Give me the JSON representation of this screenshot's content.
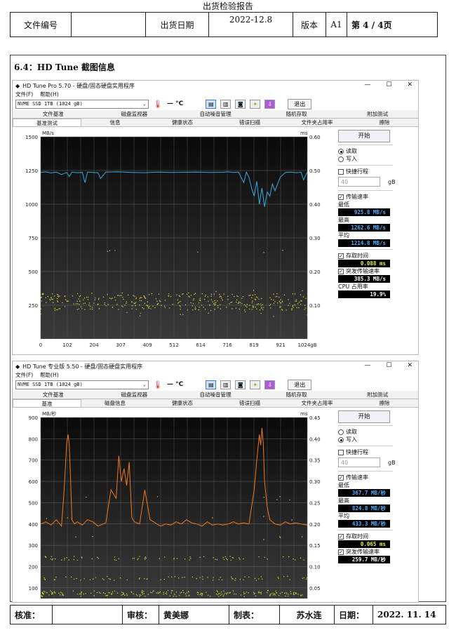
{
  "document": {
    "title": "出货检验报告",
    "section_title": "6.4：HD Tune 截图信息"
  },
  "header": {
    "doc_no_label": "文件编号",
    "doc_no_value": "",
    "ship_date_label": "出货日期",
    "ship_date_value": "2022-12.8",
    "version_label": "版本",
    "version_value": "A1",
    "page": "第 4 / 4页"
  },
  "footer": {
    "approve_label": "核准：",
    "approve_value": "",
    "review_label": "审核：",
    "review_value": "黄美娜",
    "prepare_label": "制表：",
    "prepare_value": "苏水连",
    "date_label": "日期：",
    "date_value": "2022. 11. 14"
  },
  "windows": [
    {
      "title": "HD Tune Pro 5.70 - 硬盘/固态硬盘实用程序",
      "menu": [
        "文件(F)",
        "帮助(H)"
      ],
      "drive": "NVME SSD 1TB (1024 gB)",
      "temp": "— °C",
      "exit": "退出",
      "tabs_row1": [
        "文件基准",
        "磁盘监视器",
        "自动噪音管理",
        "随机存取",
        "附加测试"
      ],
      "tabs_row2": [
        "基准测试",
        "信息",
        "健康状态",
        "错误扫描",
        "文件夹占用率",
        "擦除"
      ],
      "start": "开始",
      "read": "读取",
      "write": "写入",
      "short_stroke": "快捷行程",
      "stroke_value": "40",
      "stroke_unit": "gB",
      "transfer_rate": "传输速率",
      "min_label": "最低",
      "min_value": "925.8 MB/s",
      "max_label": "最高",
      "max_value": "1262.6 MB/s",
      "avg_label": "平均",
      "avg_value": "1214.8 MB/s",
      "access_time": "存取时间",
      "access_value": "0.088 ms",
      "burst": "突发传输速率",
      "burst_value": "385.3 MB/s",
      "cpu_label": "CPU 占用率",
      "cpu_value": "19.9%",
      "mode": "read",
      "color_line": "#39a9e0"
    },
    {
      "title": "HD Tune 专业版 5.50 - 硬盘/固态硬盘实用程序",
      "menu": [
        "文件(F)",
        "帮助(H)"
      ],
      "drive": "NVME SSD 1TB (1024 gB)",
      "temp": "— °C",
      "exit": "退出",
      "tabs_row1": [
        "文件基准",
        "磁盘监视器",
        "自动噪音管理",
        "随机存取",
        "附加测试"
      ],
      "tabs_row2": [
        "基准",
        "磁盘信息",
        "健康状态",
        "错误扫描",
        "文件夹占用率",
        "擦除"
      ],
      "start": "开始",
      "read": "读取",
      "write": "写入",
      "short_stroke": "快捷行程",
      "stroke_value": "40",
      "stroke_unit": "gB",
      "transfer_rate": "传输速率",
      "min_label": "最低",
      "min_value": "367.7 MB/秒",
      "max_label": "最高",
      "max_value": "824.8 MB/秒",
      "avg_label": "平均",
      "avg_value": "433.3 MB/秒",
      "access_time": "存取时间",
      "access_value": "0.065 ms",
      "burst": "突发传输速率",
      "burst_value": "259.7 MB/秒",
      "mode": "write",
      "color_line": "#f07a1a"
    }
  ],
  "chart_data": [
    {
      "type": "line",
      "title": "",
      "ylabel": "MB/s",
      "y2label": "ms",
      "ylim": [
        0,
        1500
      ],
      "y2lim": [
        0,
        0.6
      ],
      "yticks": [
        1500,
        1250,
        1000,
        750,
        500,
        250
      ],
      "y2ticks": [
        "0.60",
        "0.50",
        "0.40",
        "0.30",
        "0.20",
        "0.10"
      ],
      "xticks": [
        "0",
        "102",
        "204",
        "307",
        "409",
        "512",
        "614",
        "716",
        "819",
        "921",
        "1024gB"
      ],
      "series": [
        {
          "x": [
            0,
            20,
            40,
            60,
            80,
            100,
            110,
            120,
            140,
            160,
            170,
            180,
            200,
            220,
            230,
            250,
            300,
            350,
            400,
            450,
            500,
            550,
            600,
            650,
            700,
            720,
            740,
            760,
            780,
            790,
            800,
            810,
            820,
            830,
            840,
            850,
            860,
            870,
            880,
            890,
            900,
            920,
            940,
            960,
            980,
            1000,
            1010,
            1024
          ],
          "values": [
            1235,
            1240,
            1232,
            1238,
            1220,
            1236,
            1205,
            1238,
            1234,
            1236,
            1160,
            1238,
            1236,
            1234,
            1190,
            1238,
            1240,
            1236,
            1234,
            1238,
            1236,
            1237,
            1238,
            1236,
            1237,
            1240,
            1236,
            1238,
            1160,
            1238,
            1200,
            1120,
            1060,
            1170,
            1000,
            1120,
            980,
            1090,
            1060,
            1150,
            1100,
            1200,
            1236,
            1238,
            1234,
            1237,
            1180,
            1240
          ]
        }
      ],
      "access_points_ms": [
        0.13,
        0.12,
        0.11,
        0.1,
        0.09,
        0.08,
        0.07,
        0.14,
        0.26
      ]
    },
    {
      "type": "line",
      "title": "",
      "ylabel": "MB/秒",
      "y2label": "ms",
      "ylim": [
        50,
        900
      ],
      "y2lim": [
        0,
        0.45
      ],
      "yticks": [
        900,
        800,
        700,
        600,
        500,
        400,
        300,
        200,
        100
      ],
      "y2ticks": [
        "0.45",
        "0.40",
        "0.35",
        "0.30",
        "0.25",
        "0.20",
        "0.15",
        "0.10",
        "0.05"
      ],
      "series": [
        {
          "x": [
            0,
            20,
            40,
            60,
            80,
            90,
            100,
            105,
            110,
            115,
            120,
            130,
            140,
            160,
            180,
            200,
            220,
            250,
            270,
            290,
            300,
            310,
            320,
            330,
            340,
            350,
            360,
            380,
            400,
            420,
            440,
            460,
            480,
            500,
            520,
            540,
            560,
            580,
            600,
            620,
            640,
            660,
            680,
            700,
            720,
            740,
            760,
            780,
            800,
            820,
            830,
            840,
            845,
            850,
            855,
            860,
            870,
            880,
            900,
            920,
            940,
            960,
            980,
            1000,
            1024
          ],
          "values": [
            400,
            410,
            395,
            420,
            390,
            560,
            780,
            820,
            770,
            600,
            420,
            400,
            410,
            395,
            420,
            410,
            390,
            405,
            560,
            520,
            720,
            600,
            660,
            580,
            690,
            430,
            410,
            400,
            560,
            420,
            405,
            390,
            400,
            395,
            410,
            400,
            420,
            405,
            400,
            390,
            410,
            395,
            400,
            395,
            400,
            410,
            400,
            405,
            400,
            560,
            700,
            820,
            770,
            850,
            780,
            600,
            480,
            420,
            400,
            395,
            410,
            400,
            405,
            400,
            395
          ]
        }
      ],
      "access_points_ms": [
        0.01,
        0.012,
        0.015,
        0.05,
        0.1,
        0.15,
        0.2,
        0.25
      ]
    }
  ]
}
